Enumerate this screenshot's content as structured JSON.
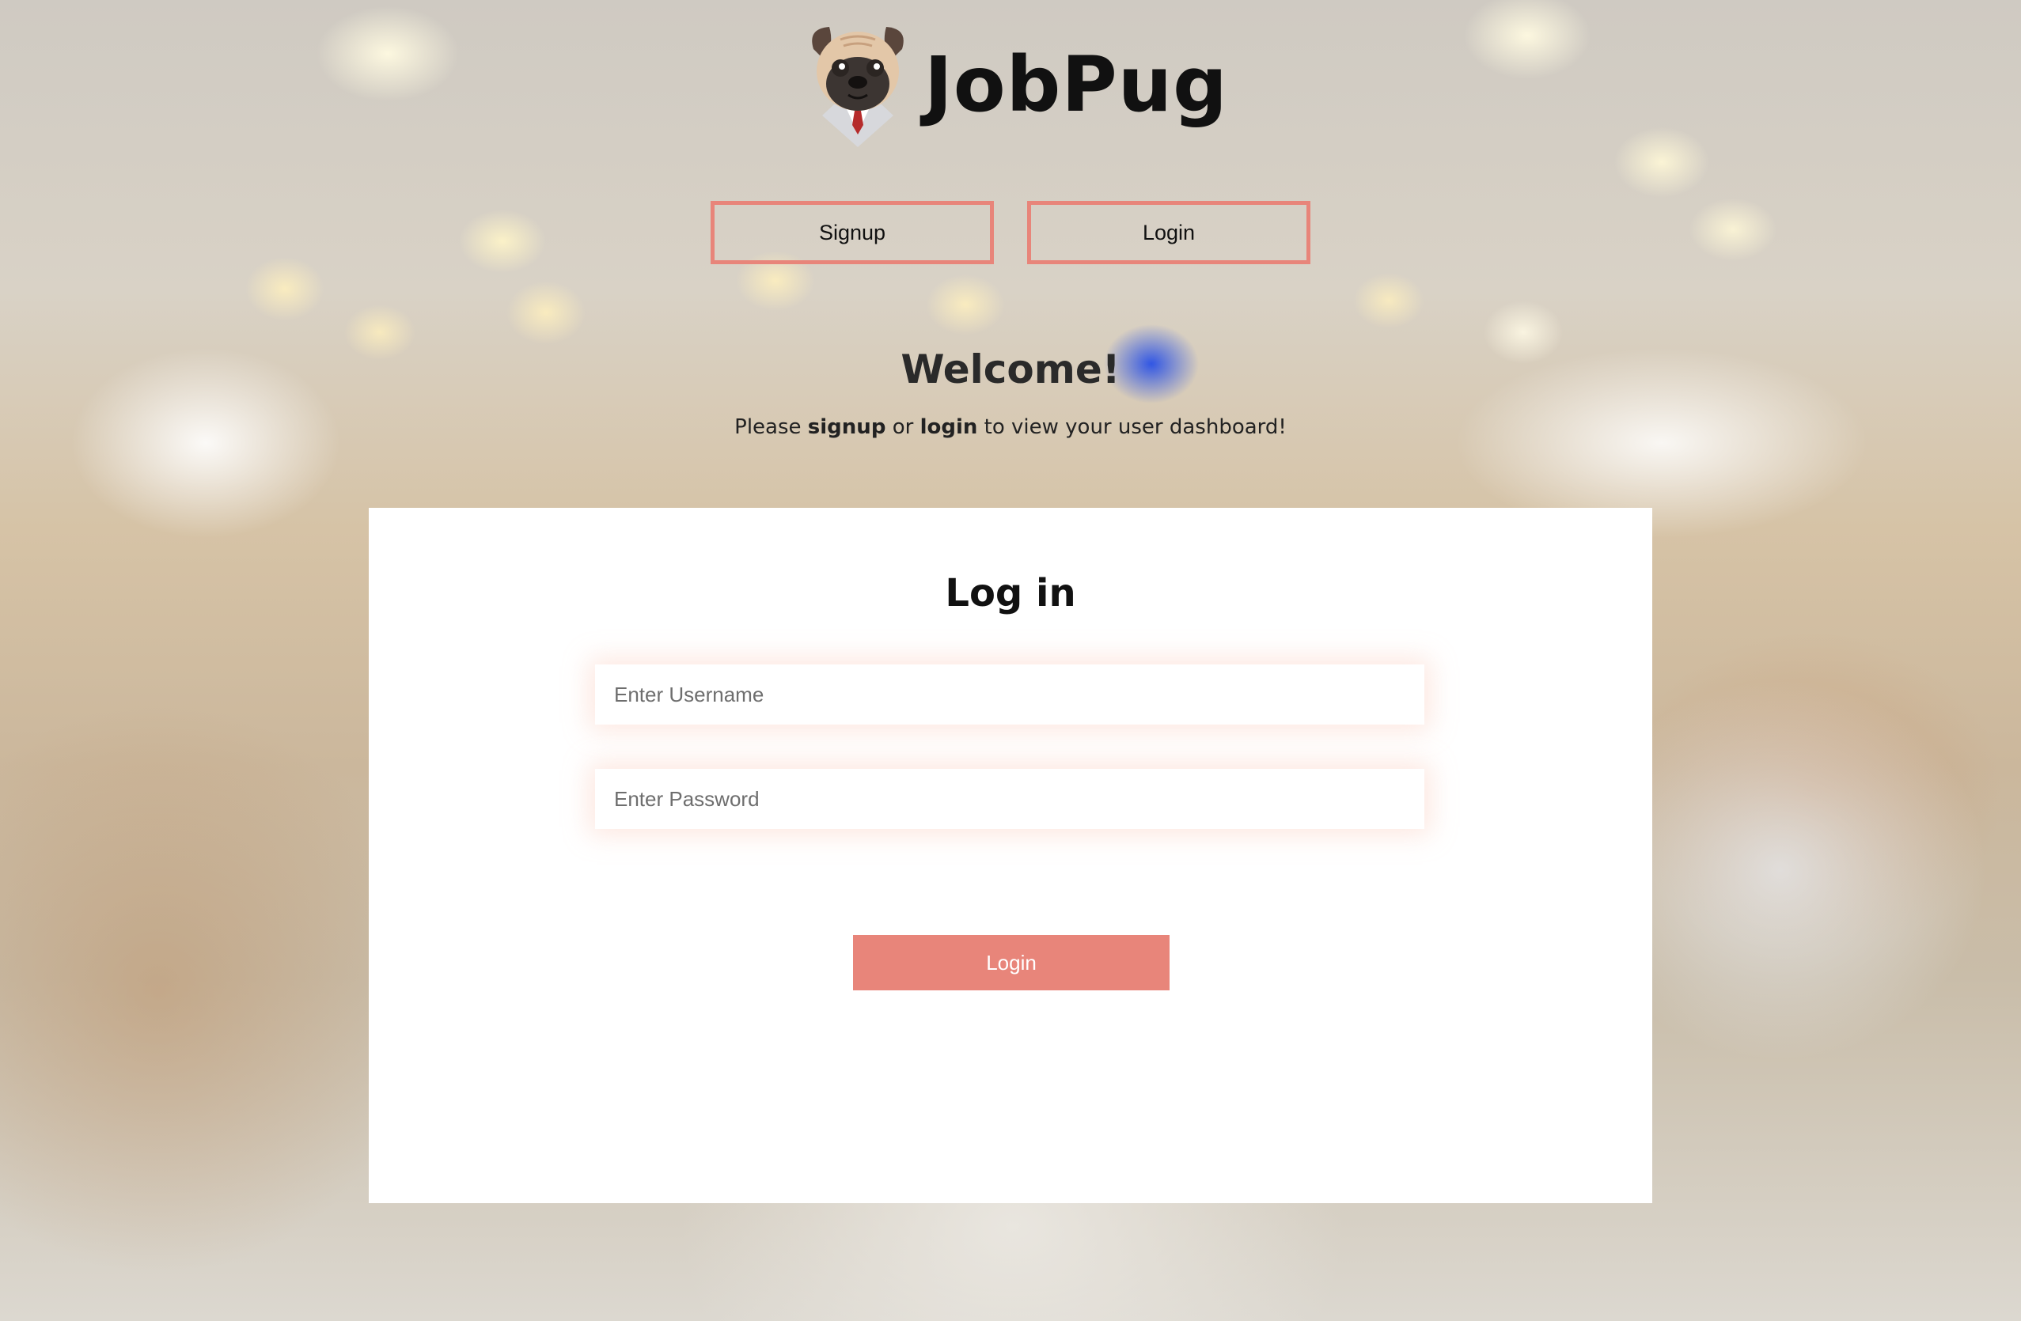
{
  "brand": {
    "name": "JobPug",
    "logo_icon": "pug-in-suit-icon"
  },
  "nav": {
    "signup_label": "Signup",
    "login_label": "Login"
  },
  "welcome": {
    "title": "Welcome!",
    "text_before": "Please",
    "signup_word": "signup",
    "text_middle": "or",
    "login_word": "login",
    "text_after": "to view your user dashboard!"
  },
  "login_form": {
    "title": "Log in",
    "username_placeholder": "Enter Username",
    "username_value": "",
    "password_placeholder": "Enter Password",
    "password_value": "",
    "submit_label": "Login"
  },
  "colors": {
    "accent": "#e8857a",
    "card_background": "#ffffff",
    "heading_text": "#111111"
  }
}
